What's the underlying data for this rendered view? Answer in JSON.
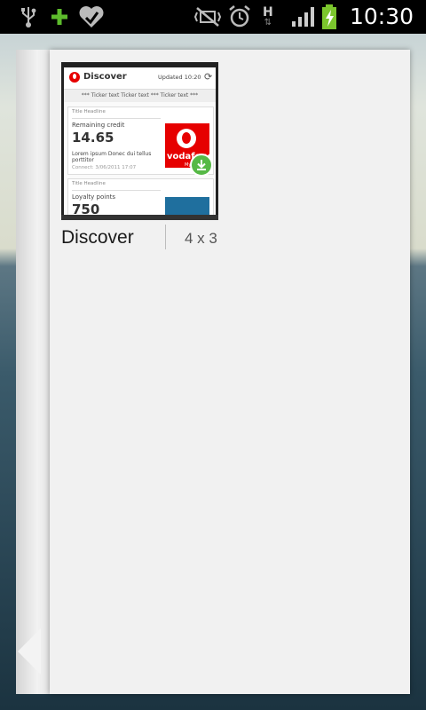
{
  "status_bar": {
    "time": "10:30",
    "icons": [
      "usb-icon",
      "add-icon",
      "health-icon",
      "vibrate-mute-icon",
      "alarm-icon",
      "hspa-data-icon",
      "signal-icon",
      "battery-charging-icon"
    ],
    "network_label": "H"
  },
  "widget": {
    "name": "Discover",
    "size": "4 x 3",
    "preview": {
      "app_title": "Discover",
      "updated": "Updated 10:20",
      "ticker": "*** Ticker text Ticker text *** Ticker text ***",
      "card1": {
        "headline": "Title Headline",
        "label": "Remaining credit",
        "value": "14.65",
        "lorem": "Lorem ipsum Donec dui tellus porttitor",
        "connect": "Connect: 3/06/2011 17:07",
        "image_text": "vodafone",
        "image_sub": "My Vod"
      },
      "card2": {
        "headline": "Title Headline",
        "label": "Loyalty points",
        "value": "750"
      }
    }
  },
  "colors": {
    "panel": "#f1f1f1",
    "vodafone_red": "#e60000",
    "download_green": "#56b946"
  }
}
